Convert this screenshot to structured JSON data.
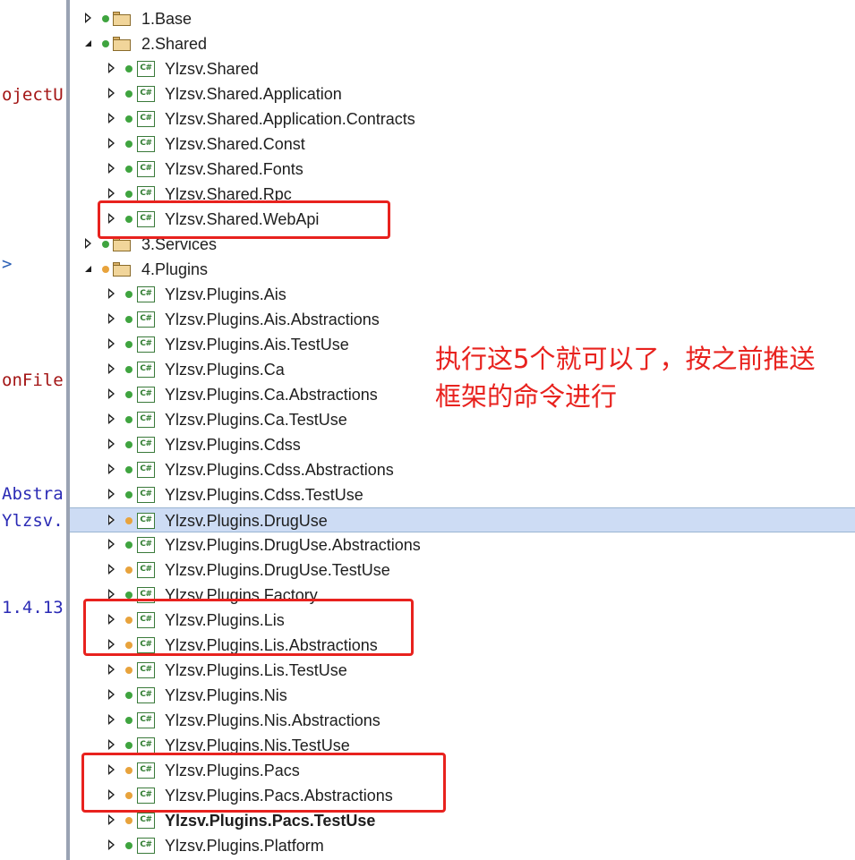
{
  "editor": {
    "lines": [
      {
        "text": "ojectU",
        "color": "#a31515"
      },
      {
        "text": ">",
        "color": "#2b5fb5"
      },
      {
        "text": "onFile",
        "color": "#a31515"
      },
      {
        "text": "Abstra",
        "color": "#2b2bb5"
      },
      {
        "text": "Ylzsv.",
        "color": "#2b2bb5"
      },
      {
        "text": "1.4.13",
        "color": "#2b2bb5"
      }
    ]
  },
  "tree": {
    "folders": {
      "base": "1.Base",
      "shared": "2.Shared",
      "services": "3.Services",
      "plugins": "4.Plugins"
    },
    "shared_projects": [
      "Ylzsv.Shared",
      "Ylzsv.Shared.Application",
      "Ylzsv.Shared.Application.Contracts",
      "Ylzsv.Shared.Const",
      "Ylzsv.Shared.Fonts",
      "Ylzsv.Shared.Rpc",
      "Ylzsv.Shared.WebApi"
    ],
    "plugin_projects": [
      "Ylzsv.Plugins.Ais",
      "Ylzsv.Plugins.Ais.Abstractions",
      "Ylzsv.Plugins.Ais.TestUse",
      "Ylzsv.Plugins.Ca",
      "Ylzsv.Plugins.Ca.Abstractions",
      "Ylzsv.Plugins.Ca.TestUse",
      "Ylzsv.Plugins.Cdss",
      "Ylzsv.Plugins.Cdss.Abstractions",
      "Ylzsv.Plugins.Cdss.TestUse",
      "Ylzsv.Plugins.DrugUse",
      "Ylzsv.Plugins.DrugUse.Abstractions",
      "Ylzsv.Plugins.DrugUse.TestUse",
      "Ylzsv.Plugins.Factory",
      "Ylzsv.Plugins.Lis",
      "Ylzsv.Plugins.Lis.Abstractions",
      "Ylzsv.Plugins.Lis.TestUse",
      "Ylzsv.Plugins.Nis",
      "Ylzsv.Plugins.Nis.Abstractions",
      "Ylzsv.Plugins.Nis.TestUse",
      "Ylzsv.Plugins.Pacs",
      "Ylzsv.Plugins.Pacs.Abstractions",
      "Ylzsv.Plugins.Pacs.TestUse",
      "Ylzsv.Plugins.Platform"
    ],
    "project_icon_text": "C#",
    "selected_project": "Ylzsv.Plugins.DrugUse",
    "startup_project": "Ylzsv.Plugins.Pacs.TestUse"
  },
  "annotation": {
    "text": "执行这5个就可以了，按之前推送框架的命令进行",
    "color": "#e8221e"
  },
  "colors": {
    "status_green": "#3fa43f",
    "status_orange": "#e8a33c",
    "selection": "#cddcf4",
    "highlight_box": "#e8221e"
  }
}
